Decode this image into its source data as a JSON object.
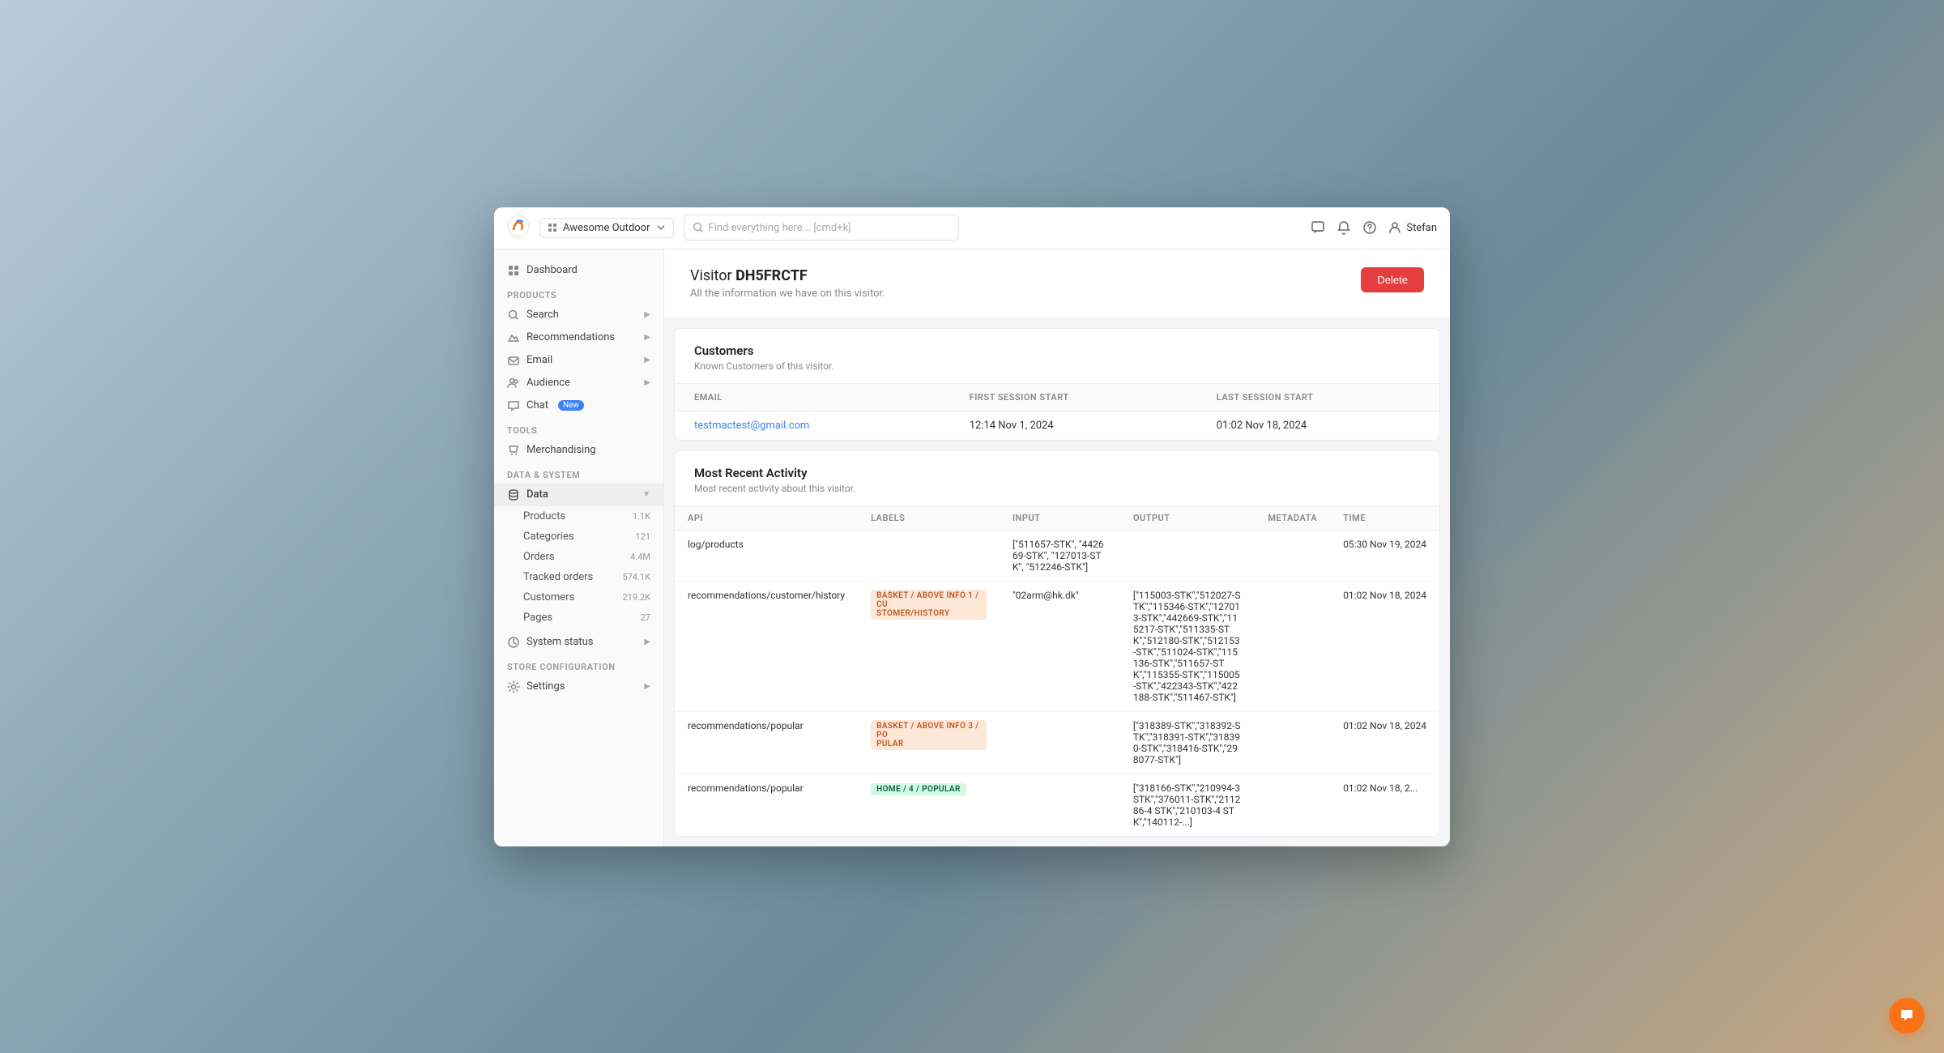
{
  "app": {
    "logo_alt": "Clerk.io logo",
    "workspace": "Awesome Outdoor",
    "search_placeholder": "Find everything here... [cmd+k]",
    "topbar_icons": [
      "comment-icon",
      "bell-icon",
      "help-icon"
    ],
    "user_name": "Stefan"
  },
  "sidebar": {
    "dashboard_label": "Dashboard",
    "sections": [
      {
        "label": "PRODUCTS",
        "items": [
          {
            "id": "search",
            "label": "Search",
            "arrow": true
          },
          {
            "id": "recommendations",
            "label": "Recommendations",
            "arrow": true
          },
          {
            "id": "email",
            "label": "Email",
            "arrow": true
          },
          {
            "id": "audience",
            "label": "Audience",
            "arrow": true
          },
          {
            "id": "chat",
            "label": "Chat",
            "badge": "New"
          }
        ]
      },
      {
        "label": "TOOLS",
        "items": [
          {
            "id": "merchandising",
            "label": "Merchandising"
          }
        ]
      },
      {
        "label": "DATA & SYSTEM",
        "items": [
          {
            "id": "data",
            "label": "Data",
            "arrow": true,
            "expanded": true
          }
        ]
      }
    ],
    "data_sub_items": [
      {
        "label": "Products",
        "count": "1.1K"
      },
      {
        "label": "Categories",
        "count": "121"
      },
      {
        "label": "Orders",
        "count": "4.4M"
      },
      {
        "label": "Tracked orders",
        "count": "574.1K"
      },
      {
        "label": "Customers",
        "count": "219.2K"
      },
      {
        "label": "Pages",
        "count": "27"
      }
    ],
    "system_status_label": "System status",
    "store_config_section": "STORE CONFIGURATION",
    "settings_label": "Settings"
  },
  "visitor": {
    "title_prefix": "Visitor",
    "visitor_id": "DH5FRCTF",
    "subtitle": "All the information we have on this visitor.",
    "delete_label": "Delete"
  },
  "customers_section": {
    "title": "Customers",
    "subtitle": "Known Customers of this visitor.",
    "table_headers": [
      "EMAIL",
      "FIRST SESSION START",
      "LAST SESSION START"
    ],
    "rows": [
      {
        "email": "testmactest@gmail.com",
        "first_session": "12:14 Nov 1, 2024",
        "last_session": "01:02 Nov 18, 2024"
      }
    ]
  },
  "activity_section": {
    "title": "Most Recent Activity",
    "subtitle": "Most recent activity about this visitor.",
    "table_headers": [
      "API",
      "LABELS",
      "INPUT",
      "OUTPUT",
      "METADATA",
      "TIME"
    ],
    "rows": [
      {
        "api": "log/products",
        "labels": [],
        "input": "[\"511657-STK\", \"442669-STK\", \"127013-STK\", \"512246-STK\"]",
        "output": "",
        "metadata": "",
        "time": "05:30 Nov 19, 2024"
      },
      {
        "api": "recommendations/customer/history",
        "labels": [
          {
            "text": "BASKET / ABOVE INFO 1 / CUSTOMER/HISTORY",
            "type": "basket"
          }
        ],
        "input": "\"02arm@hk.dk\"",
        "output": "[\"115003-STK\",\"512027-STK\",\"115346-STK\",\"127013-STK\",\"442669-STK\",\"115217-STK\",\"511335-STK\",\"512180-STK\",\"512153-STK\",\"511024-STK\",\"115136-STK\",\"511657-STK\",\"115355-STK\",\"115005-STK\",\"422343-STK\",\"422188-STK\",\"511467-STK\"]",
        "metadata": "",
        "time": "01:02 Nov 18, 2024"
      },
      {
        "api": "recommendations/popular",
        "labels": [
          {
            "text": "BASKET / ABOVE INFO 3 / POPULAR",
            "type": "basket"
          }
        ],
        "input": "",
        "output": "[\"318389-STK\",\"318392-STK\",\"318391-STK\",\"318390-STK\",\"318416-STK\",\"298077-STK\"]",
        "metadata": "",
        "time": "01:02 Nov 18, 2024"
      },
      {
        "api": "recommendations/popular",
        "labels": [
          {
            "text": "HOME / 4 / POPULAR",
            "type": "home"
          }
        ],
        "input": "",
        "output": "[\"318166-STK\",\"210994-3 STK\",\"376011-STK\",\"211286-4 STK\",\"210103-4 STK\",\"140112-...\"]",
        "metadata": "",
        "time": "01:02 Nov 18, 2..."
      }
    ]
  }
}
